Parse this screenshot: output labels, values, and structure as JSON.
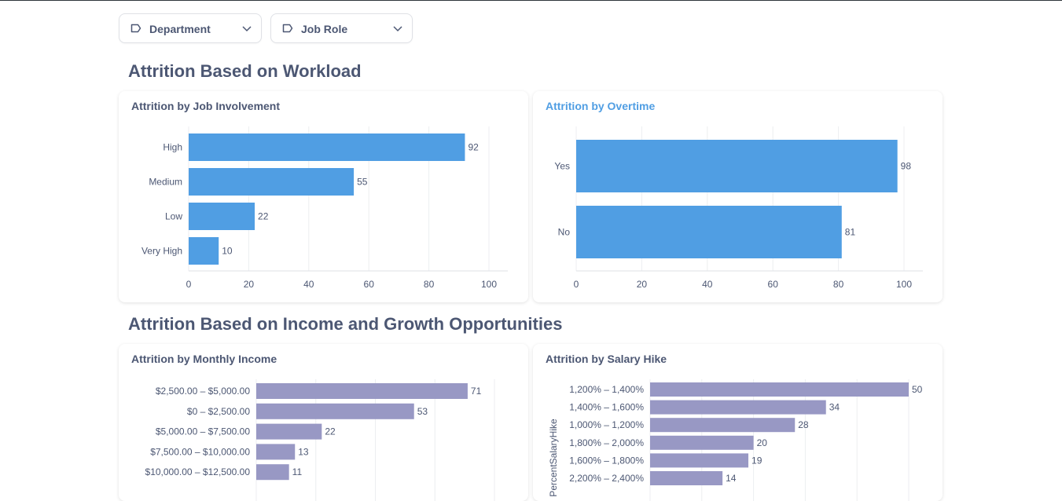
{
  "filters": [
    {
      "label": "Department",
      "icon": "tag-icon"
    },
    {
      "label": "Job Role",
      "icon": "tag-icon"
    }
  ],
  "sections": [
    {
      "title": "Attrition Based on Workload"
    },
    {
      "title": "Attrition Based on Income and Growth Opportunities"
    }
  ],
  "colors": {
    "blue_bar": "#509ee3",
    "purple_bar": "#9898c4",
    "text": "#4c5773",
    "accent": "#509ee3"
  },
  "chart_data": [
    {
      "id": "job_involvement",
      "type": "bar",
      "orientation": "horizontal",
      "title": "Attrition by Job Involvement",
      "categories": [
        "High",
        "Medium",
        "Low",
        "Very High"
      ],
      "values": [
        92,
        55,
        22,
        10
      ],
      "xticks": [
        0,
        20,
        40,
        60,
        80,
        100
      ],
      "xlim": [
        0,
        100
      ],
      "grid": true,
      "color": "#509ee3"
    },
    {
      "id": "overtime",
      "type": "bar",
      "orientation": "horizontal",
      "title": "Attrition by Overtime",
      "categories": [
        "Yes",
        "No"
      ],
      "values": [
        98,
        81
      ],
      "xticks": [
        0,
        20,
        40,
        60,
        80,
        100
      ],
      "xlim": [
        0,
        100
      ],
      "grid": true,
      "color": "#509ee3"
    },
    {
      "id": "monthly_income",
      "type": "bar",
      "orientation": "horizontal",
      "title": "Attrition by Monthly Income",
      "categories": [
        "$2,500.00 – $5,000.00",
        "$0 – $2,500.00",
        "$5,000.00 – $7,500.00",
        "$7,500.00 – $10,000.00",
        "$10,000.00 – $12,500.00"
      ],
      "values": [
        71,
        53,
        22,
        13,
        11
      ],
      "xlim": [
        0,
        80
      ],
      "grid": true,
      "color": "#9898c4"
    },
    {
      "id": "salary_hike",
      "type": "bar",
      "orientation": "horizontal",
      "title": "Attrition by Salary Hike",
      "ylabel": "PercentSalaryHike",
      "categories": [
        "1,200% – 1,400%",
        "1,400% – 1,600%",
        "1,000% – 1,200%",
        "1,800% – 2,000%",
        "1,600% – 1,800%",
        "2,200% – 2,400%"
      ],
      "values": [
        50,
        34,
        28,
        20,
        19,
        14
      ],
      "xlim": [
        0,
        50
      ],
      "grid": true,
      "color": "#9898c4"
    }
  ]
}
